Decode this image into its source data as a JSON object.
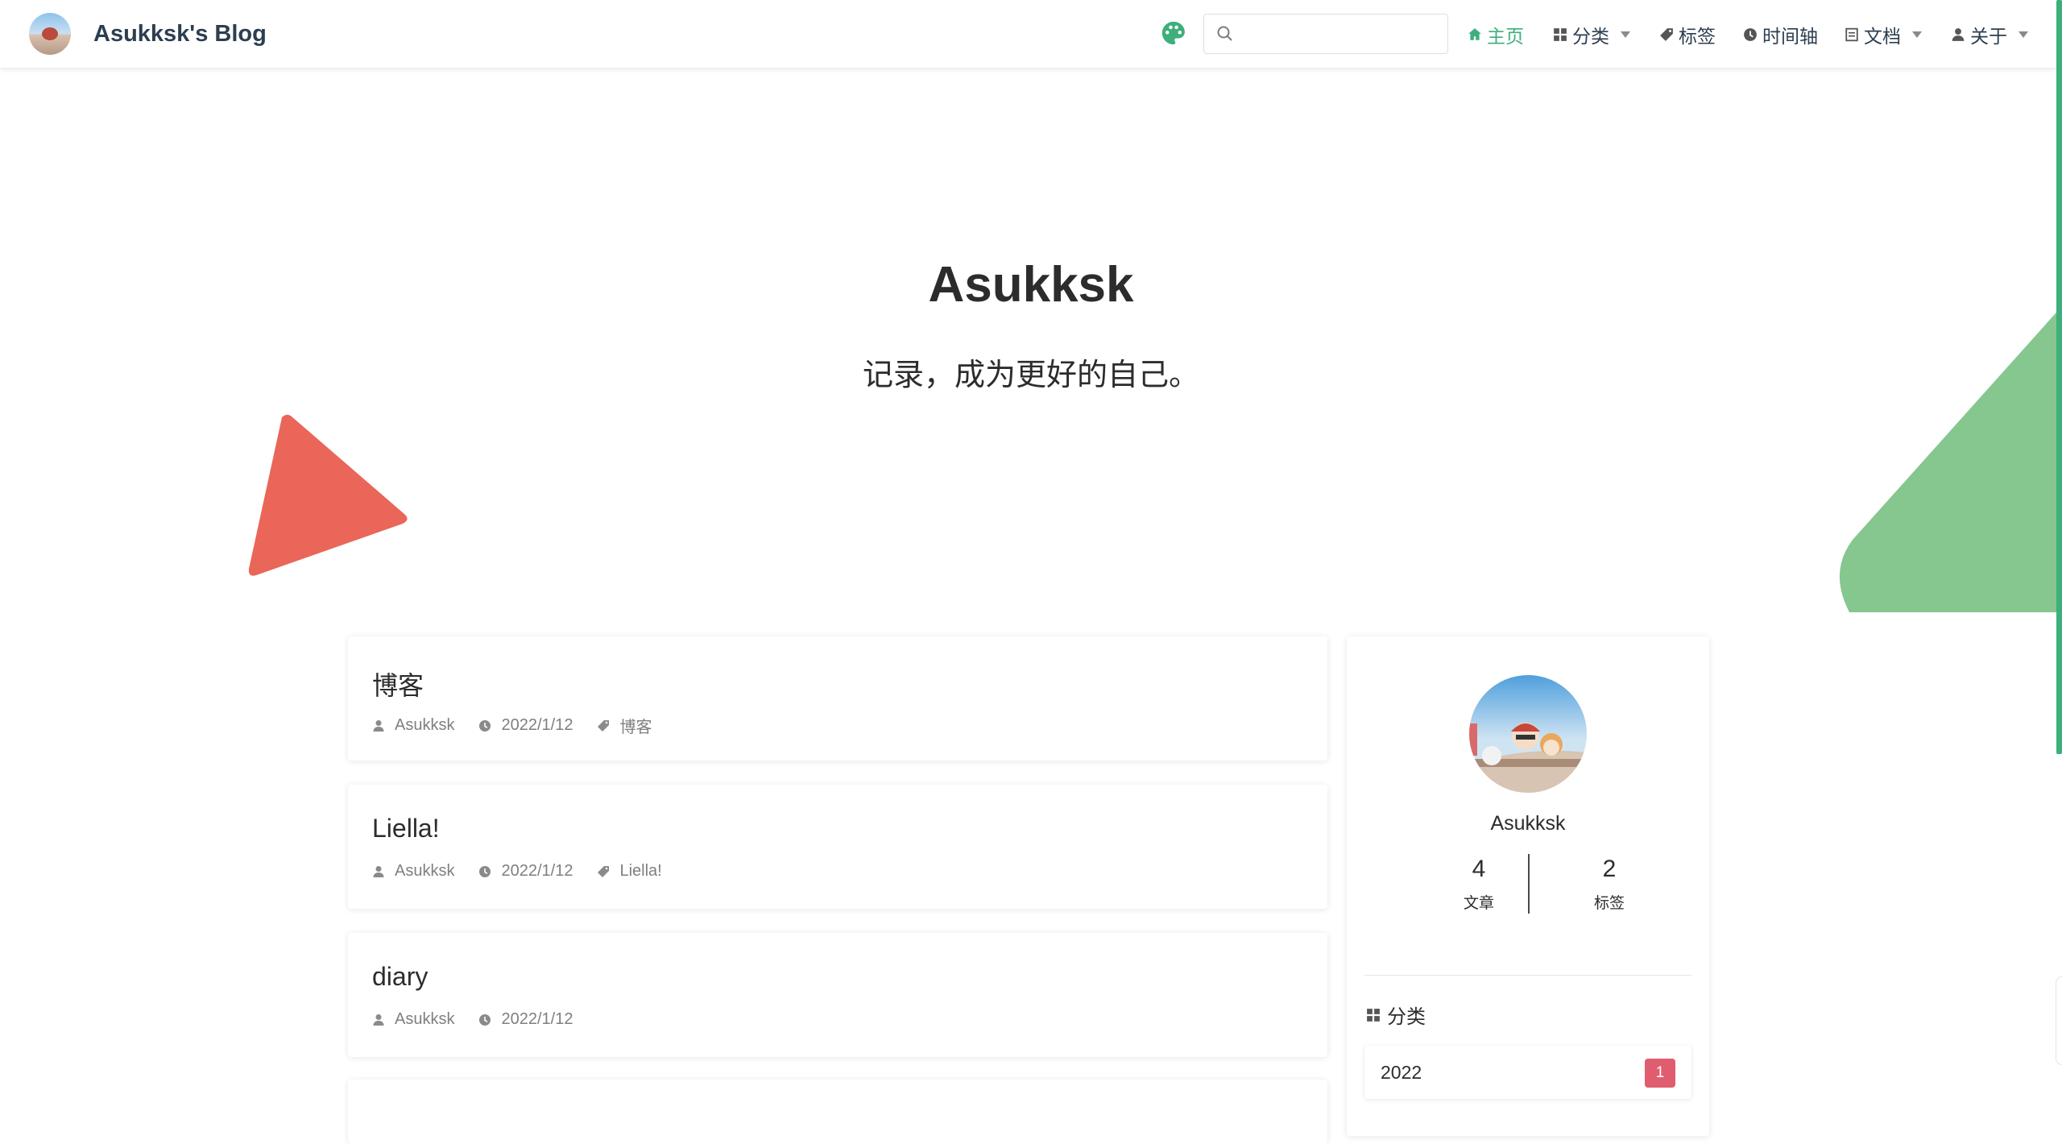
{
  "site": {
    "title": "Asukksk's Blog"
  },
  "search": {
    "value": "",
    "placeholder": ""
  },
  "nav": {
    "home": "主页",
    "category": "分类",
    "tags": "标签",
    "timeline": "时间轴",
    "docs": "文档",
    "about": "关于"
  },
  "hero": {
    "title": "Asukksk",
    "subtitle": "记录，成为更好的自己。"
  },
  "posts": [
    {
      "title": "博客",
      "author": "Asukksk",
      "date": "2022/1/12",
      "tag": "博客"
    },
    {
      "title": "Liella!",
      "author": "Asukksk",
      "date": "2022/1/12",
      "tag": "Liella!"
    },
    {
      "title": "diary",
      "author": "Asukksk",
      "date": "2022/1/12",
      "tag": ""
    }
  ],
  "profile": {
    "name": "Asukksk",
    "articles": {
      "count": "4",
      "label": "文章"
    },
    "tags": {
      "count": "2",
      "label": "标签"
    }
  },
  "categories": {
    "heading": "分类",
    "items": [
      {
        "name": "2022",
        "count": "1"
      }
    ]
  },
  "colors": {
    "accent": "#3eaf7c",
    "badge": "#e05d6f",
    "triangle_red": "#e96659",
    "triangle_green": "#85c78f"
  }
}
